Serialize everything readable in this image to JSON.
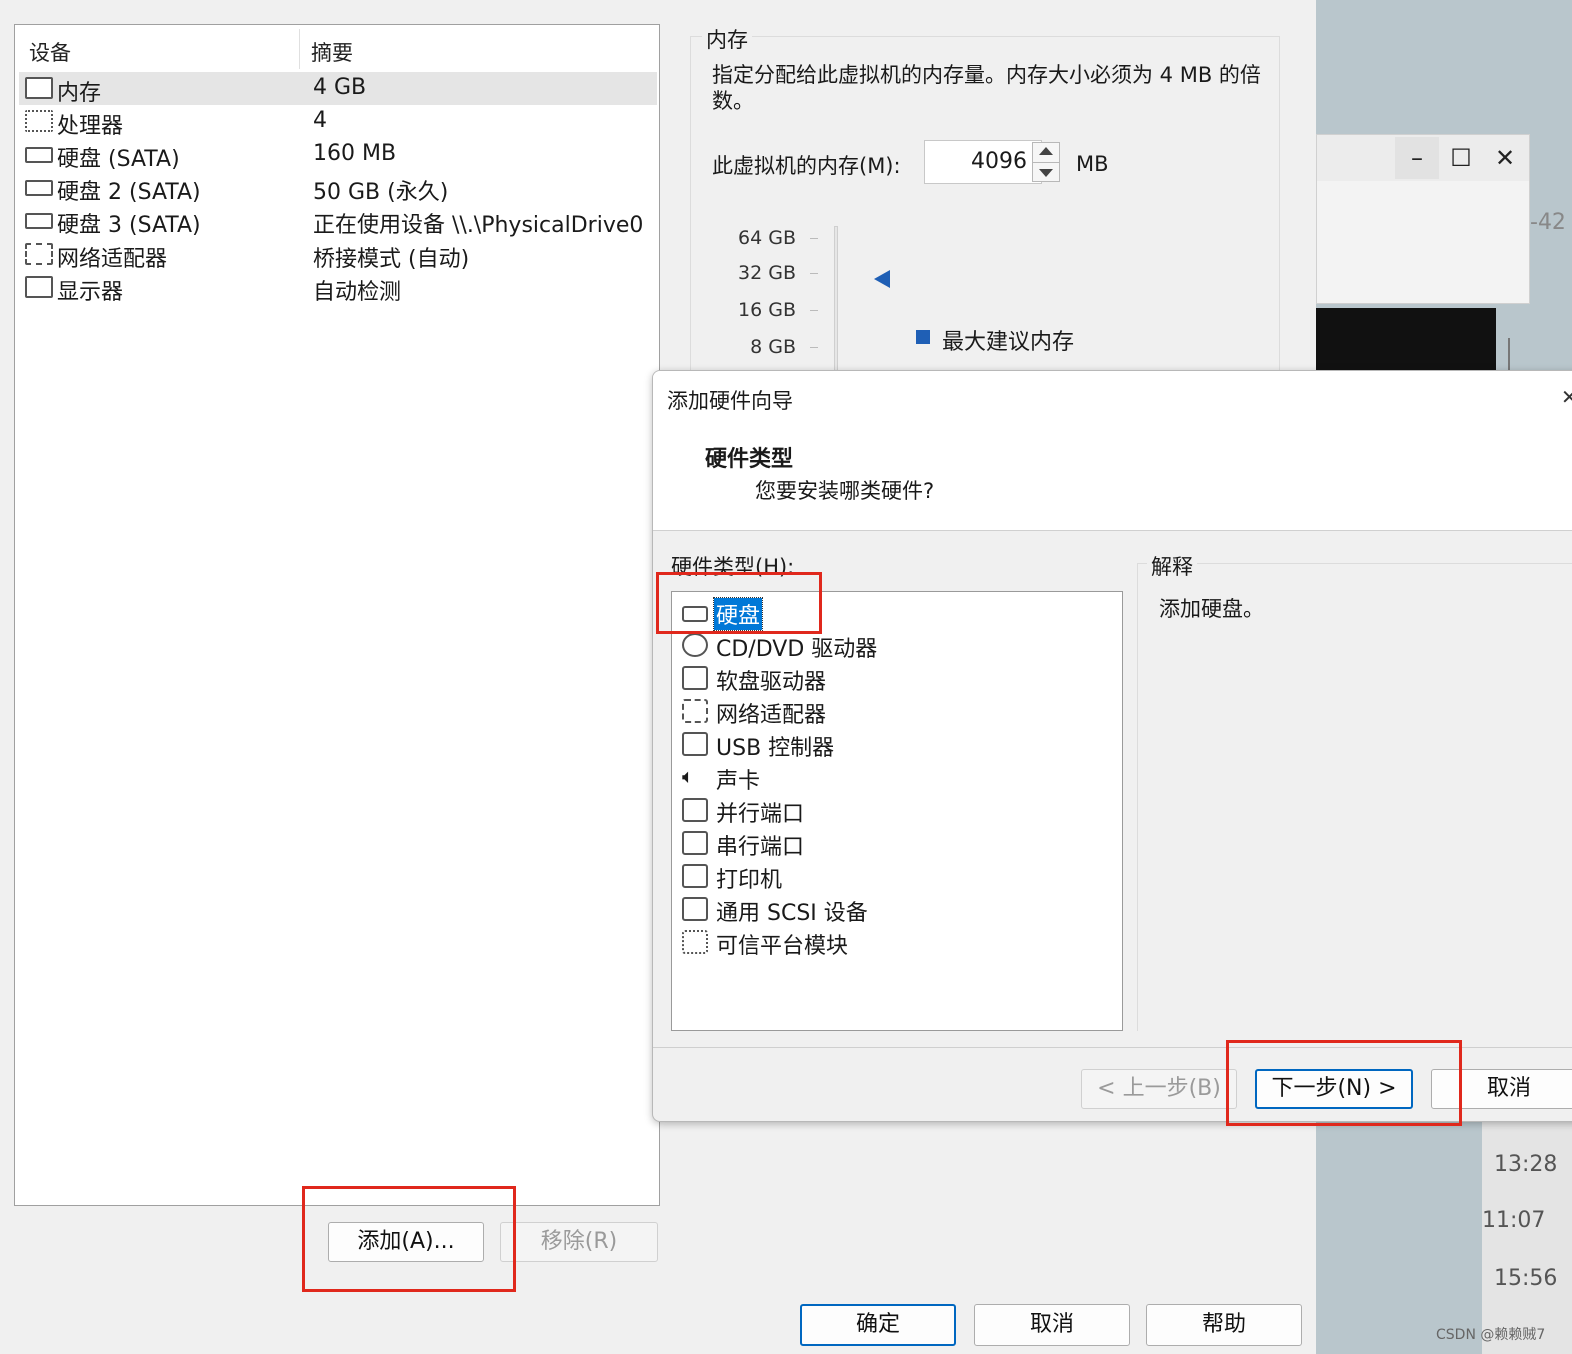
{
  "devices": {
    "col_device": "设备",
    "col_summary": "摘要",
    "rows": [
      {
        "name": "内存",
        "summary": "4 GB",
        "icon": "memory-icon"
      },
      {
        "name": "处理器",
        "summary": "4",
        "icon": "processor-icon"
      },
      {
        "name": "硬盘 (SATA)",
        "summary": "160 MB",
        "icon": "hard-disk-icon"
      },
      {
        "name": "硬盘 2 (SATA)",
        "summary": "50 GB (永久)",
        "icon": "hard-disk-icon"
      },
      {
        "name": "硬盘 3 (SATA)",
        "summary": "正在使用设备 \\\\.\\PhysicalDrive0",
        "icon": "hard-disk-icon"
      },
      {
        "name": "网络适配器",
        "summary": "桥接模式 (自动)",
        "icon": "network-adapter-icon"
      },
      {
        "name": "显示器",
        "summary": "自动检测",
        "icon": "display-icon"
      }
    ],
    "add_button": "添加(A)...",
    "remove_button": "移除(R)"
  },
  "memory": {
    "group_title": "内存",
    "description": "指定分配给此虚拟机的内存量。内存大小必须为 4 MB 的倍数。",
    "field_label": "此虚拟机的内存(M):",
    "value": "4096",
    "unit": "MB",
    "scale": [
      "64 GB",
      "32 GB",
      "16 GB",
      "8 GB"
    ],
    "legend": "最大建议内存",
    "legend_color": "#1f5fb5"
  },
  "wizard": {
    "window_title": "添加硬件向导",
    "heading": "硬件类型",
    "subheading": "您要安装哪类硬件?",
    "list_label": "硬件类型(H):",
    "items": [
      {
        "label": "硬盘",
        "icon": "hard-disk-icon"
      },
      {
        "label": "CD/DVD 驱动器",
        "icon": "cd-dvd-icon"
      },
      {
        "label": "软盘驱动器",
        "icon": "floppy-icon"
      },
      {
        "label": "网络适配器",
        "icon": "network-adapter-icon"
      },
      {
        "label": "USB 控制器",
        "icon": "usb-icon"
      },
      {
        "label": "声卡",
        "icon": "speaker-icon"
      },
      {
        "label": "并行端口",
        "icon": "parallel-port-icon"
      },
      {
        "label": "串行端口",
        "icon": "serial-port-icon"
      },
      {
        "label": "打印机",
        "icon": "printer-icon"
      },
      {
        "label": "通用 SCSI 设备",
        "icon": "scsi-icon"
      },
      {
        "label": "可信平台模块",
        "icon": "tpm-icon"
      }
    ],
    "selected_index": 0,
    "explain_title": "解释",
    "explain_text": "添加硬盘。",
    "back_button": "< 上一步(B)",
    "next_button": "下一步(N) >",
    "cancel_button": "取消"
  },
  "dialog_buttons": {
    "ok": "确定",
    "cancel": "取消",
    "help": "帮助"
  },
  "background": {
    "edge_text": "-42",
    "times": [
      "13:28",
      "11:07",
      "15:56"
    ]
  },
  "watermark": "CSDN @赖赖贼7"
}
